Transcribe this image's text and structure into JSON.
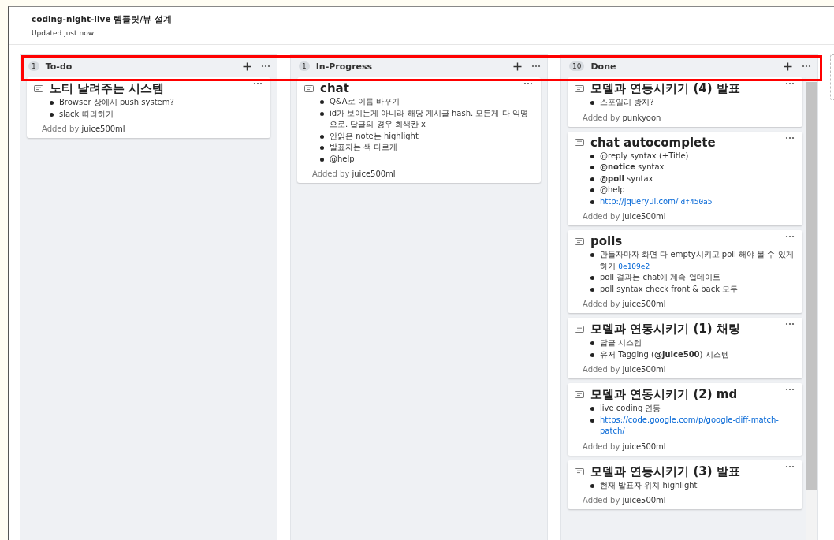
{
  "project": {
    "title": "coding-night-live 템플릿/뷰 설계",
    "subtitle": "Updated just now"
  },
  "highlight_headers": true,
  "columns": [
    {
      "count": "1",
      "name": "To-do",
      "scrollbar": false,
      "cards": [
        {
          "title": "노티 날려주는 시스템",
          "items": [
            {
              "text": "Browser 상에서 push system?"
            },
            {
              "text": "slack 따라하기"
            }
          ],
          "added_by": "Added by **juice500ml**"
        }
      ]
    },
    {
      "count": "1",
      "name": "In-Progress",
      "scrollbar": false,
      "cards": [
        {
          "title": "chat",
          "items": [
            {
              "text": "Q&A로 이름 바꾸기"
            },
            {
              "text": "id가 보이는게 아니라 해당 게시글 hash. 모든게 다 익명으로. 답글의 경우 회색칸 x"
            },
            {
              "text": "안읽은 note는 highlight"
            },
            {
              "text": "발표자는 색 다르게"
            },
            {
              "text": "@help"
            }
          ],
          "added_by": "Added by **juice500ml**"
        }
      ]
    },
    {
      "count": "10",
      "name": "Done",
      "scrollbar": true,
      "cards": [
        {
          "title": "모델과 연동시키기 (4) 발표",
          "items": [
            {
              "text": "스포일러 방지?"
            }
          ],
          "added_by": "Added by **punkyoon**"
        },
        {
          "title": "chat autocomplete",
          "items": [
            {
              "text": "@reply syntax (+Title)"
            },
            {
              "text": "**@notice** syntax"
            },
            {
              "text": "**@poll** syntax"
            },
            {
              "text": "@help"
            },
            {
              "link": "http://jqueryui.com/",
              "hash": "df450a5"
            }
          ],
          "added_by": "Added by **juice500ml**"
        },
        {
          "title": "polls",
          "items": [
            {
              "text": "만들자마자 화면 다 empty시키고 poll 해야 볼 수 있게 하기",
              "hash": "0e109e2"
            },
            {
              "text": "poll 결과는 chat에 계속 업데이트"
            },
            {
              "text": "poll syntax check front & back 모두"
            }
          ],
          "added_by": "Added by **juice500ml**"
        },
        {
          "title": "모델과 연동시키기 (1) 채팅",
          "items": [
            {
              "text": "답글 시스템"
            },
            {
              "text": "유저 Tagging (**@juice500**) 시스템"
            }
          ],
          "added_by": "Added by **juice500ml**"
        },
        {
          "title": "모델과 연동시키기 (2) md",
          "items": [
            {
              "text": "live coding 연동"
            },
            {
              "link": "https://code.google.com/p/google-diff-match-patch/"
            }
          ],
          "added_by": "Added by **juice500ml**"
        },
        {
          "title": "모델과 연동시키기 (3) 발표",
          "items": [
            {
              "text": "현재 발표자 위치 highlight"
            }
          ],
          "added_by": "Added by **juice500ml**"
        }
      ]
    }
  ]
}
